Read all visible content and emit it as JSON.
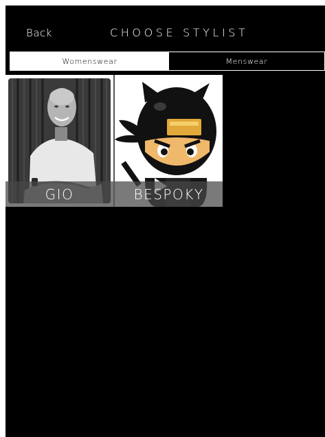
{
  "nav": {
    "back_label": "Back",
    "title": "CHOOSE STYLIST"
  },
  "segments": [
    {
      "label": "Womenswear",
      "selected": true
    },
    {
      "label": "Menswear",
      "selected": false
    }
  ],
  "stylists": [
    {
      "name": "GIO",
      "image": "stylist-photo"
    },
    {
      "name": "BESPOKY",
      "image": "ninja-avatar"
    }
  ],
  "colors": {
    "background": "#000000",
    "text": "#ffffff",
    "selected_segment_bg": "#ffffff",
    "label_band": "#464646"
  }
}
